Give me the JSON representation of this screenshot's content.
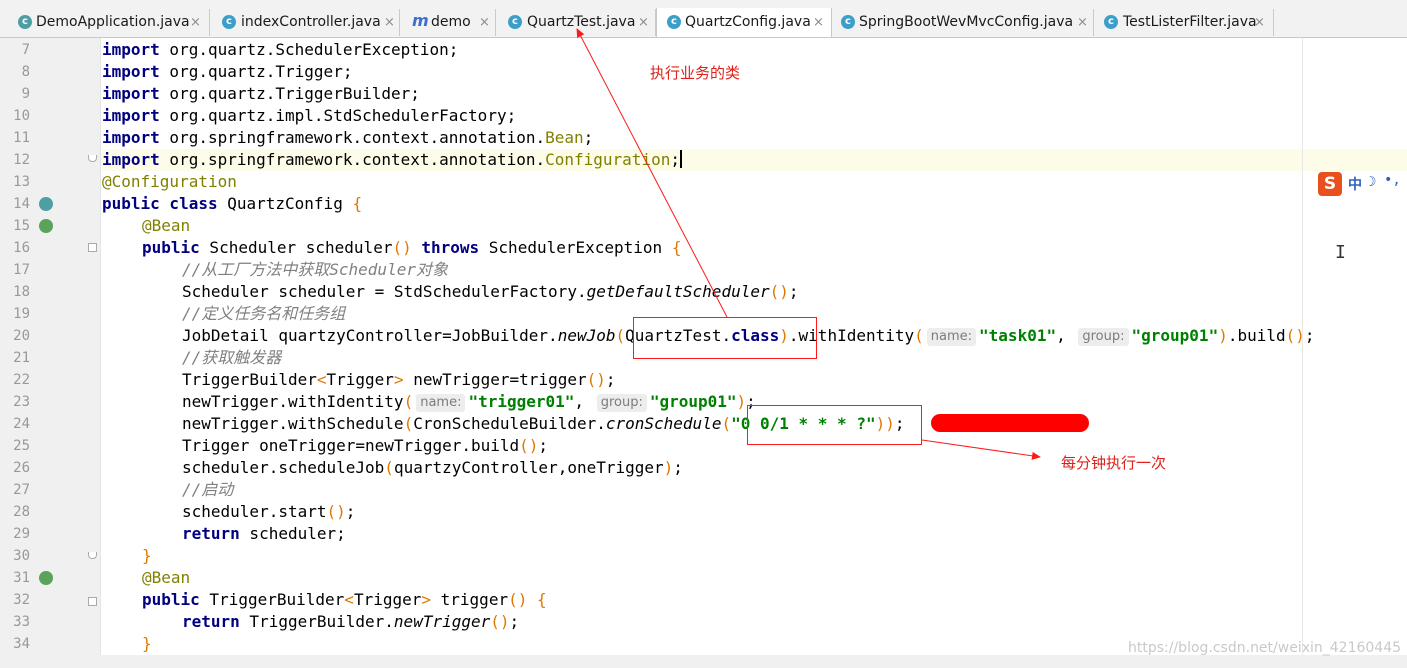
{
  "tabs": [
    {
      "label": "DemoApplication.java",
      "icon": "spring-class-icon",
      "close": "×"
    },
    {
      "label": "indexController.java",
      "icon": "class-icon",
      "close": "×"
    },
    {
      "label": "demo",
      "icon": "maven-icon",
      "close": "×"
    },
    {
      "label": "QuartzTest.java",
      "icon": "class-icon",
      "close": "×"
    },
    {
      "label": "QuartzConfig.java",
      "icon": "class-icon",
      "close": "×"
    },
    {
      "label": "SpringBootWevMvcConfig.java",
      "icon": "class-icon",
      "close": "×"
    },
    {
      "label": "TestListerFilter.java",
      "icon": "class-icon",
      "close": "×"
    }
  ],
  "active_tab": "QuartzConfig.java",
  "tab_icon_glyphs": {
    "class": "c",
    "maven": "m"
  },
  "line_numbers": [
    "7",
    "8",
    "9",
    "10",
    "11",
    "12",
    "13",
    "14",
    "15",
    "16",
    "17",
    "18",
    "19",
    "20",
    "21",
    "22",
    "23",
    "24",
    "25",
    "26",
    "27",
    "28",
    "29",
    "30",
    "31",
    "32",
    "33",
    "34"
  ],
  "code": {
    "import_kw": "import",
    "l7": " org.quartz.SchedulerException;",
    "l8": " org.quartz.Trigger;",
    "l9": " org.quartz.TriggerBuilder;",
    "l10": " org.quartz.impl.StdSchedulerFactory;",
    "l11_a": " org.springframework.context.annotation.",
    "l11_b": "Bean",
    "l11_c": ";",
    "l12_a": " org.springframework.context.annotation.",
    "l12_b": "Configuration",
    "l12_c": ";",
    "l13": "@Configuration",
    "l14_kw": "public class",
    "l14_name": " QuartzConfig ",
    "l14_brace": "{",
    "bean": "@Bean",
    "l16_kw": "public",
    "l16_a": " Scheduler scheduler",
    "l16_p": "()",
    "l16_throws": "throws",
    "l16_b": " SchedulerException ",
    "l16_brace": "{",
    "l17": "//从工厂方法中获取Scheduler对象",
    "l18_a": "Scheduler scheduler = StdSchedulerFactory.",
    "l18_m": "getDefaultScheduler",
    "l18_p": "()",
    "l18_c": ";",
    "l19": "//定义任务名和任务组",
    "l20_a": "JobDetail quartzyController=JobBuilder.",
    "l20_m": "newJob",
    "l20_po": "(",
    "l20_b": "QuartzTest.",
    "l20_kw": "class",
    "l20_pc": ")",
    "l20_c": ".withIdentity",
    "l20_po2": "(",
    "hint_name": "name:",
    "hint_group": "group:",
    "l20_s1": "\"task01\"",
    "comma": ", ",
    "l20_s2": "\"group01\"",
    "l20_pc2": ")",
    "l20_d": ".build",
    "l20_p3": "()",
    "semi": ";",
    "l21": "//获取触发器",
    "l22_a": "TriggerBuilder",
    "l22_lt": "<",
    "l22_t": "Trigger",
    "l22_gt": ">",
    "l22_b": " newTrigger=trigger",
    "l22_p": "()",
    "l23_a": "newTrigger.withIdentity",
    "l23_s1": "\"trigger01\"",
    "l23_s2": "\"group01\"",
    "l24_a": "newTrigger.withSchedule",
    "l24_b": "CronScheduleBuilder.",
    "l24_m": "cronSchedule",
    "l24_s": "\"0 0/1 * * * ?\"",
    "l24_pp": "))",
    "l25_a": "Trigger oneTrigger=newTrigger.build",
    "l26_a": "scheduler.scheduleJob",
    "l26_b": "quartzyController,oneTrigger",
    "l27": "//启动",
    "l28_a": "scheduler.start",
    "l29_kw": "return",
    "l29_b": " scheduler;",
    "close_brace": "}",
    "l32_kw": "public",
    "l32_a": " TriggerBuilder",
    "l32_t": "Trigger",
    "l32_b": " trigger",
    "l32_brace": " {",
    "l33_kw": "return",
    "l33_a": " TriggerBuilder.",
    "l33_m": "newTrigger"
  },
  "annotations": {
    "business_class_note": "执行业务的类",
    "per_minute_note": "每分钟执行一次"
  },
  "ime": {
    "logo": "S",
    "mode": "中",
    "moon": "☽",
    "dots": "•,"
  },
  "watermark": "https://blog.csdn.net/weixin_42160445",
  "colors": {
    "keyword": "#000080",
    "annotation": "#808000",
    "string": "#008000",
    "comment": "#808080",
    "red": "#ff0000"
  }
}
